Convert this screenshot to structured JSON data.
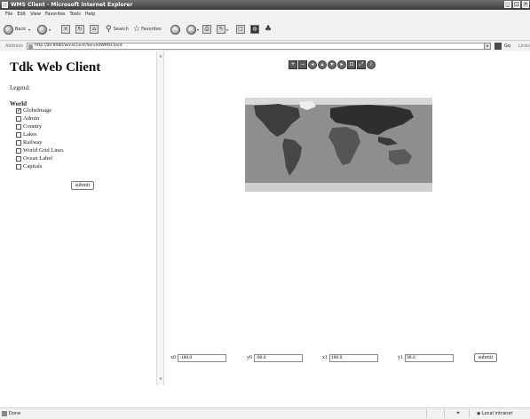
{
  "window": {
    "title": "WMS Client - Microsoft Internet Explorer",
    "minimize": "_",
    "maximize": "□",
    "close": "×"
  },
  "menu": [
    "File",
    "Edit",
    "View",
    "Favorites",
    "Tools",
    "Help"
  ],
  "toolbar": {
    "back": "Back",
    "search": "Search",
    "favorites": "Favorites"
  },
  "address": {
    "label": "Address",
    "url": "http://ibl:8080/wmsClient/ServletWMSClient",
    "go": "Go",
    "links": "Links"
  },
  "page": {
    "title": "Tdk Web Client",
    "legend": "Legend:",
    "group": "World",
    "layers": [
      {
        "label": "GlobeImage",
        "checked": true
      },
      {
        "label": "Admin",
        "checked": false
      },
      {
        "label": "Country",
        "checked": false
      },
      {
        "label": "Lakes",
        "checked": false
      },
      {
        "label": "Railway",
        "checked": false
      },
      {
        "label": "World Grid Lines",
        "checked": false
      },
      {
        "label": "Ocean Label",
        "checked": false
      },
      {
        "label": "Capitals",
        "checked": false
      }
    ],
    "submit": "submit"
  },
  "map": {
    "tools": [
      {
        "name": "zoom-in-icon",
        "glyph": "+"
      },
      {
        "name": "zoom-out-icon",
        "glyph": "−"
      },
      {
        "name": "pan-west-icon",
        "glyph": "◂"
      },
      {
        "name": "pan-north-icon",
        "glyph": "▴"
      },
      {
        "name": "pan-south-icon",
        "glyph": "▾"
      },
      {
        "name": "pan-east-icon",
        "glyph": "▸"
      },
      {
        "name": "zoom-box-icon",
        "glyph": "⊡"
      },
      {
        "name": "full-extent-icon",
        "glyph": "⤢"
      },
      {
        "name": "info-icon",
        "glyph": "i"
      }
    ],
    "fields": [
      {
        "label": "x0",
        "value": "-180.0"
      },
      {
        "label": "y0",
        "value": "-90.0"
      },
      {
        "label": "x1",
        "value": "180.0"
      },
      {
        "label": "y1",
        "value": "90.0"
      }
    ],
    "submit": "submit"
  },
  "status": {
    "text": "Done",
    "zone": "Local intranet"
  }
}
